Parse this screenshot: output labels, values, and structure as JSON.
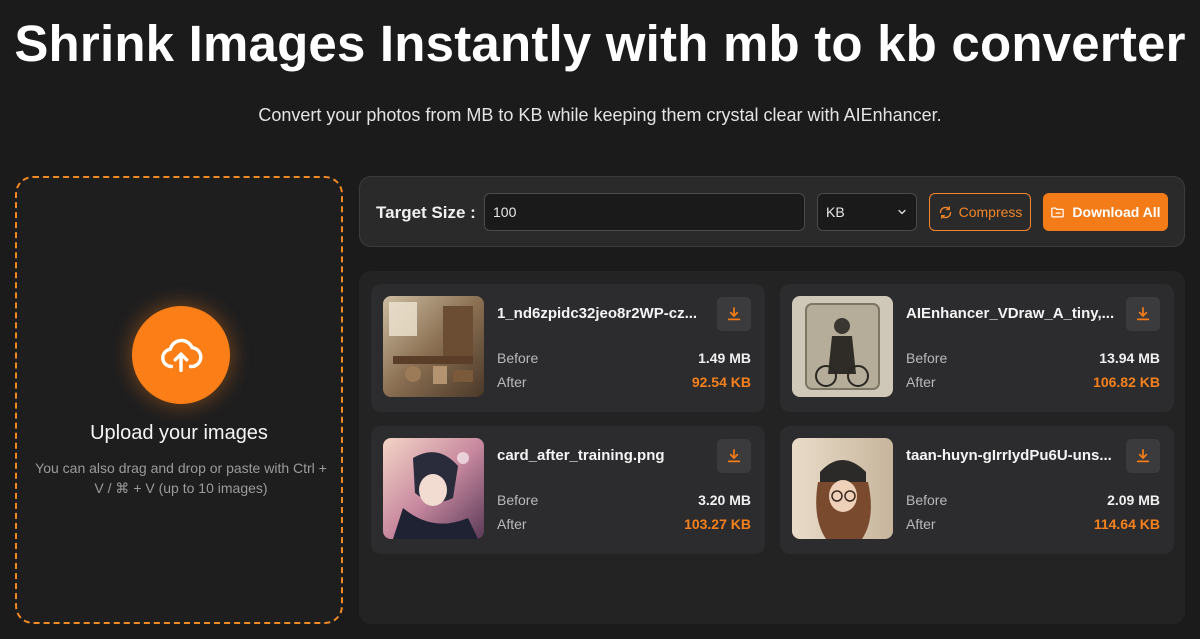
{
  "header": {
    "title": "Shrink Images Instantly with mb to kb converter",
    "subtitle": "Convert your photos from MB to KB while keeping them crystal clear with AIEnhancer."
  },
  "upload": {
    "title": "Upload your images",
    "hint": "You can also drag and drop or paste with Ctrl + V / ⌘ + V (up to 10 images)",
    "icon": "cloud-upload-icon"
  },
  "toolbar": {
    "label": "Target Size :",
    "target_value": "100",
    "unit": "KB",
    "compress_label": "Compress",
    "download_all_label": "Download All"
  },
  "labels": {
    "before": "Before",
    "after": "After"
  },
  "files": [
    {
      "name": "1_nd6zpidc32jeo8r2WP-cz...",
      "before": "1.49 MB",
      "after": "92.54 KB"
    },
    {
      "name": "AIEnhancer_VDraw_A_tiny,...",
      "before": "13.94 MB",
      "after": "106.82 KB"
    },
    {
      "name": "card_after_training.png",
      "before": "3.20 MB",
      "after": "103.27 KB"
    },
    {
      "name": "taan-huyn-gIrrIydPu6U-uns...",
      "before": "2.09 MB",
      "after": "114.64 KB"
    }
  ],
  "colors": {
    "accent": "#f47c18",
    "background": "#1b1b1c",
    "panel": "#2a2a2b"
  }
}
